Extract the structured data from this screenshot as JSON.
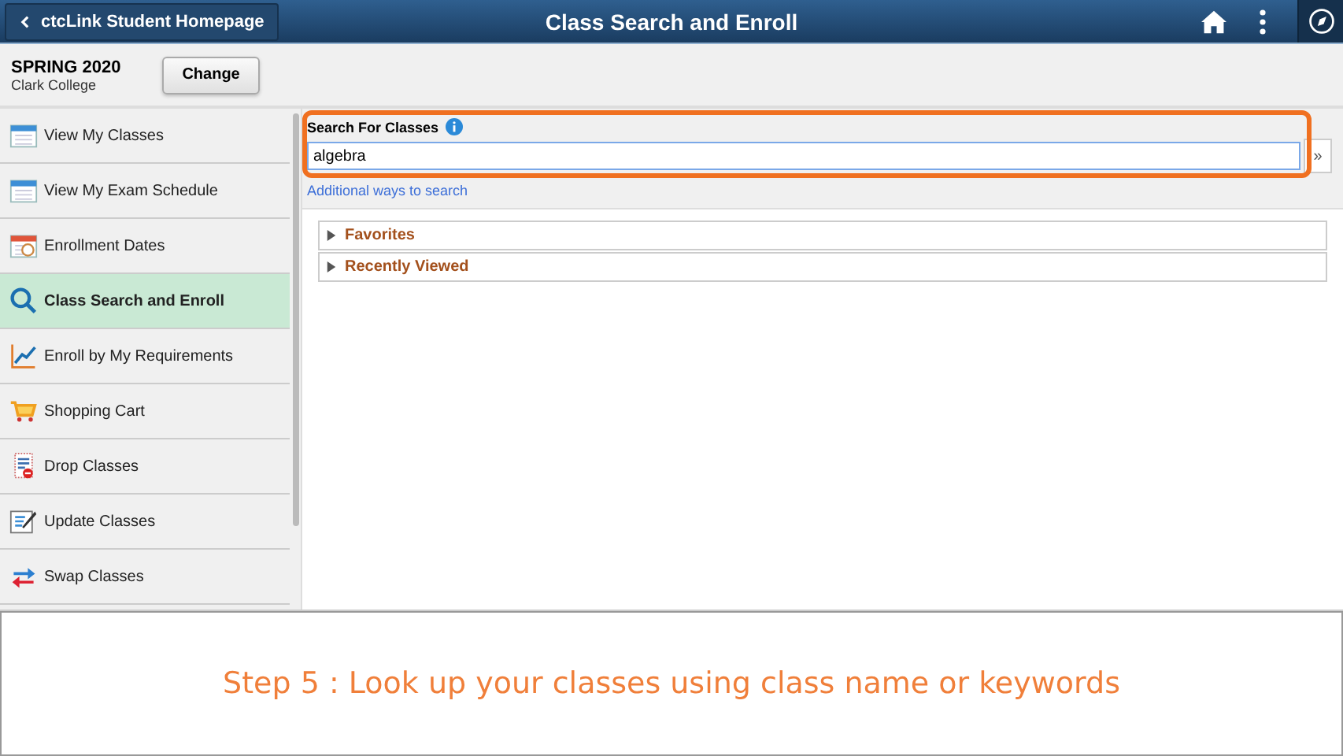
{
  "header": {
    "back_button": "ctcLink Student Homepage",
    "title": "Class Search and Enroll"
  },
  "term": {
    "name": "SPRING 2020",
    "institution": "Clark College",
    "change_button": "Change"
  },
  "sidebar": {
    "items": [
      {
        "label": "View My Classes",
        "selected": false
      },
      {
        "label": "View My Exam Schedule",
        "selected": false
      },
      {
        "label": "Enrollment Dates",
        "selected": false
      },
      {
        "label": "Class Search and Enroll",
        "selected": true
      },
      {
        "label": "Enroll by My Requirements",
        "selected": false
      },
      {
        "label": "Shopping Cart",
        "selected": false
      },
      {
        "label": "Drop Classes",
        "selected": false
      },
      {
        "label": "Update Classes",
        "selected": false
      },
      {
        "label": "Swap Classes",
        "selected": false
      }
    ]
  },
  "search": {
    "label": "Search For Classes",
    "value": "algebra",
    "next_button": "»",
    "link": "Additional ways to search"
  },
  "sections": [
    {
      "label": "Favorites",
      "expanded": false
    },
    {
      "label": "Recently Viewed",
      "expanded": false
    }
  ],
  "caption": "Step 5 : Look up your classes using class name or keywords"
}
